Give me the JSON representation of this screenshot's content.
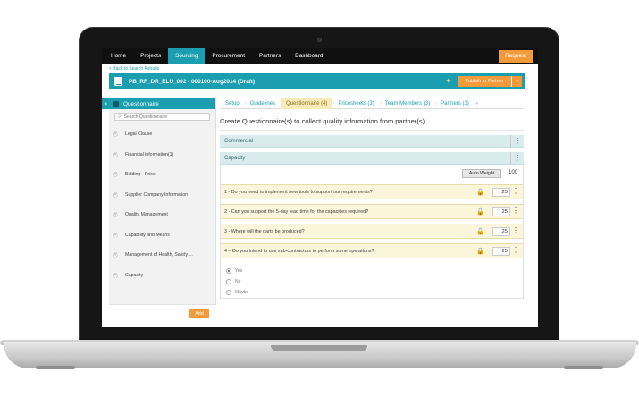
{
  "topnav": {
    "items": [
      "Home",
      "Projects",
      "Sourcing",
      "Procurement",
      "Partners",
      "Dashboard"
    ],
    "active_index": 2,
    "request_label": "Request"
  },
  "back_link": "< Back to Search Results",
  "titlebar": {
    "title": "PB_RF_DR_ELU_002 - 000100-Aug2014  (Draft)",
    "publish_label": "Publish to Partner",
    "publish_caret": "▾"
  },
  "sidebar": {
    "collapse_glyph": "◂",
    "header": "Questionnaire",
    "search_placeholder": "Search Questionnaire",
    "items": [
      "Legal Clause",
      "Financial information(1)",
      "Bidding - Price",
      "Supplier Company Information",
      "Quality Management",
      "Capability and Means",
      "Management of Health, Safety ...",
      "Capacity"
    ],
    "add_label": "Add"
  },
  "tabs": {
    "items": [
      "Setup",
      "Guidelines",
      "Questionnaire (4)",
      "Pricesheets (3)",
      "Team Members (3)",
      "Partners (3)"
    ],
    "active_index": 2,
    "more": "›"
  },
  "main": {
    "heading": "Create Questionnaire(s) to collect quality information from partner(s).",
    "sections": [
      "Commercial",
      "Capacity"
    ],
    "auto_weight_label": "Auto Weight",
    "auto_weight_total": "100",
    "questions": [
      {
        "text": "1 - Do you need to implement new tools to support our requirements?",
        "weight": "25"
      },
      {
        "text": "2 - Can you support the 5-day lead time for the capacities required?",
        "weight": "25"
      },
      {
        "text": "3 - Where will the parts be produced?",
        "weight": "25"
      },
      {
        "text": "4 – Do you intend to use sub-contractors to perform some operations?",
        "weight": "25"
      }
    ],
    "options": [
      "Yes",
      "No",
      "Maybe"
    ],
    "selected_option": "Yes"
  },
  "colors": {
    "accent": "#1b9fb0",
    "orange": "#f39b3b",
    "question_bg": "#fbf5dc",
    "section_bg": "#d8eced"
  }
}
